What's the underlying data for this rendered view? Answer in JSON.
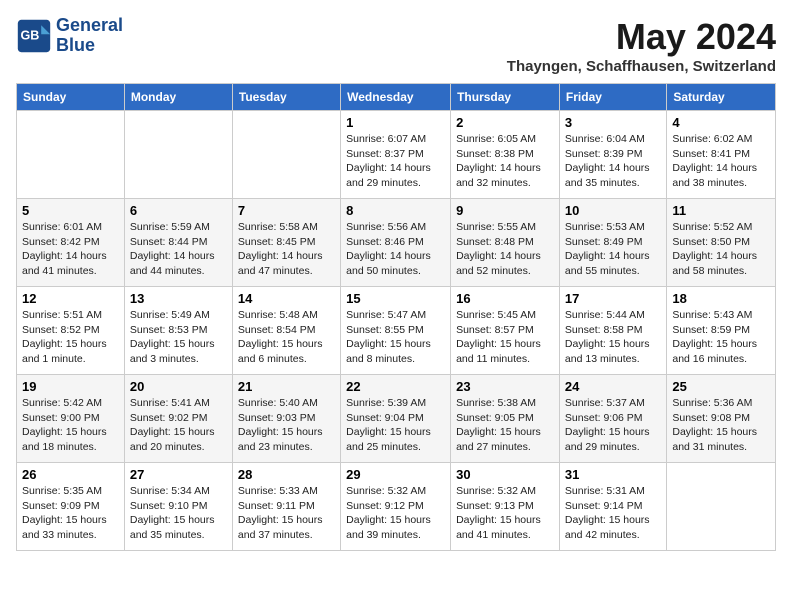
{
  "header": {
    "logo_line1": "General",
    "logo_line2": "Blue",
    "month": "May 2024",
    "location": "Thayngen, Schaffhausen, Switzerland"
  },
  "columns": [
    "Sunday",
    "Monday",
    "Tuesday",
    "Wednesday",
    "Thursday",
    "Friday",
    "Saturday"
  ],
  "weeks": [
    [
      {
        "day": "",
        "info": ""
      },
      {
        "day": "",
        "info": ""
      },
      {
        "day": "",
        "info": ""
      },
      {
        "day": "1",
        "info": "Sunrise: 6:07 AM\nSunset: 8:37 PM\nDaylight: 14 hours\nand 29 minutes."
      },
      {
        "day": "2",
        "info": "Sunrise: 6:05 AM\nSunset: 8:38 PM\nDaylight: 14 hours\nand 32 minutes."
      },
      {
        "day": "3",
        "info": "Sunrise: 6:04 AM\nSunset: 8:39 PM\nDaylight: 14 hours\nand 35 minutes."
      },
      {
        "day": "4",
        "info": "Sunrise: 6:02 AM\nSunset: 8:41 PM\nDaylight: 14 hours\nand 38 minutes."
      }
    ],
    [
      {
        "day": "5",
        "info": "Sunrise: 6:01 AM\nSunset: 8:42 PM\nDaylight: 14 hours\nand 41 minutes."
      },
      {
        "day": "6",
        "info": "Sunrise: 5:59 AM\nSunset: 8:44 PM\nDaylight: 14 hours\nand 44 minutes."
      },
      {
        "day": "7",
        "info": "Sunrise: 5:58 AM\nSunset: 8:45 PM\nDaylight: 14 hours\nand 47 minutes."
      },
      {
        "day": "8",
        "info": "Sunrise: 5:56 AM\nSunset: 8:46 PM\nDaylight: 14 hours\nand 50 minutes."
      },
      {
        "day": "9",
        "info": "Sunrise: 5:55 AM\nSunset: 8:48 PM\nDaylight: 14 hours\nand 52 minutes."
      },
      {
        "day": "10",
        "info": "Sunrise: 5:53 AM\nSunset: 8:49 PM\nDaylight: 14 hours\nand 55 minutes."
      },
      {
        "day": "11",
        "info": "Sunrise: 5:52 AM\nSunset: 8:50 PM\nDaylight: 14 hours\nand 58 minutes."
      }
    ],
    [
      {
        "day": "12",
        "info": "Sunrise: 5:51 AM\nSunset: 8:52 PM\nDaylight: 15 hours\nand 1 minute."
      },
      {
        "day": "13",
        "info": "Sunrise: 5:49 AM\nSunset: 8:53 PM\nDaylight: 15 hours\nand 3 minutes."
      },
      {
        "day": "14",
        "info": "Sunrise: 5:48 AM\nSunset: 8:54 PM\nDaylight: 15 hours\nand 6 minutes."
      },
      {
        "day": "15",
        "info": "Sunrise: 5:47 AM\nSunset: 8:55 PM\nDaylight: 15 hours\nand 8 minutes."
      },
      {
        "day": "16",
        "info": "Sunrise: 5:45 AM\nSunset: 8:57 PM\nDaylight: 15 hours\nand 11 minutes."
      },
      {
        "day": "17",
        "info": "Sunrise: 5:44 AM\nSunset: 8:58 PM\nDaylight: 15 hours\nand 13 minutes."
      },
      {
        "day": "18",
        "info": "Sunrise: 5:43 AM\nSunset: 8:59 PM\nDaylight: 15 hours\nand 16 minutes."
      }
    ],
    [
      {
        "day": "19",
        "info": "Sunrise: 5:42 AM\nSunset: 9:00 PM\nDaylight: 15 hours\nand 18 minutes."
      },
      {
        "day": "20",
        "info": "Sunrise: 5:41 AM\nSunset: 9:02 PM\nDaylight: 15 hours\nand 20 minutes."
      },
      {
        "day": "21",
        "info": "Sunrise: 5:40 AM\nSunset: 9:03 PM\nDaylight: 15 hours\nand 23 minutes."
      },
      {
        "day": "22",
        "info": "Sunrise: 5:39 AM\nSunset: 9:04 PM\nDaylight: 15 hours\nand 25 minutes."
      },
      {
        "day": "23",
        "info": "Sunrise: 5:38 AM\nSunset: 9:05 PM\nDaylight: 15 hours\nand 27 minutes."
      },
      {
        "day": "24",
        "info": "Sunrise: 5:37 AM\nSunset: 9:06 PM\nDaylight: 15 hours\nand 29 minutes."
      },
      {
        "day": "25",
        "info": "Sunrise: 5:36 AM\nSunset: 9:08 PM\nDaylight: 15 hours\nand 31 minutes."
      }
    ],
    [
      {
        "day": "26",
        "info": "Sunrise: 5:35 AM\nSunset: 9:09 PM\nDaylight: 15 hours\nand 33 minutes."
      },
      {
        "day": "27",
        "info": "Sunrise: 5:34 AM\nSunset: 9:10 PM\nDaylight: 15 hours\nand 35 minutes."
      },
      {
        "day": "28",
        "info": "Sunrise: 5:33 AM\nSunset: 9:11 PM\nDaylight: 15 hours\nand 37 minutes."
      },
      {
        "day": "29",
        "info": "Sunrise: 5:32 AM\nSunset: 9:12 PM\nDaylight: 15 hours\nand 39 minutes."
      },
      {
        "day": "30",
        "info": "Sunrise: 5:32 AM\nSunset: 9:13 PM\nDaylight: 15 hours\nand 41 minutes."
      },
      {
        "day": "31",
        "info": "Sunrise: 5:31 AM\nSunset: 9:14 PM\nDaylight: 15 hours\nand 42 minutes."
      },
      {
        "day": "",
        "info": ""
      }
    ]
  ]
}
